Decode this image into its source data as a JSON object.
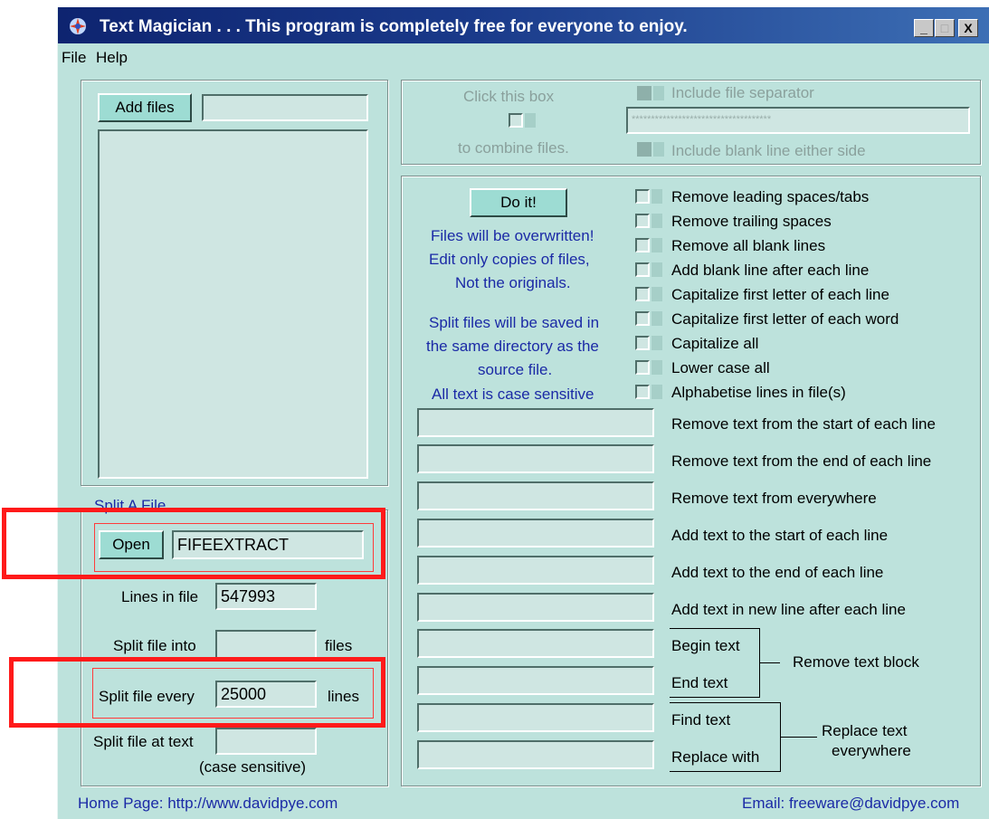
{
  "window": {
    "title": "Text Magician . . . This program is completely free for everyone to enjoy.",
    "controls": {
      "minimize": "_",
      "maximize": "□",
      "close": "X"
    }
  },
  "menu": {
    "file": "File",
    "help": "Help"
  },
  "files_panel": {
    "add_files_label": "Add files",
    "path_value": ""
  },
  "combine_panel": {
    "click_line1": "Click this box",
    "click_line2": "to combine files.",
    "include_separator": "Include file separator",
    "separator_value": "************************************",
    "include_blank": "Include blank line either side"
  },
  "actions": {
    "do_it_label": "Do it!",
    "warning_lines": [
      "Files will be overwritten!",
      "Edit only copies of files,",
      "Not the originals."
    ],
    "split_note_lines": [
      "Split files will be saved in",
      "the same directory as the",
      "source file."
    ],
    "case_note": "All text is case sensitive"
  },
  "options": [
    "Remove leading spaces/tabs",
    "Remove trailing spaces",
    "Remove all blank lines",
    "Add blank line after each line",
    "Capitalize first letter of each line",
    "Capitalize first letter of each word",
    "Capitalize all",
    "Lower case all",
    "Alphabetise lines in file(s)"
  ],
  "text_ops": [
    "Remove text from the start of each line",
    "Remove text from the end of each line",
    "Remove text from everywhere",
    "Add text to the start of each line",
    "Add text to the end of each line",
    "Add text in new line after each line"
  ],
  "block_ops": {
    "begin_text": "Begin text",
    "end_text": "End text",
    "remove_block": "Remove text block",
    "find_text": "Find text",
    "replace_with": "Replace with",
    "replace_everywhere_line1": "Replace text",
    "replace_everywhere_line2": "everywhere"
  },
  "split": {
    "section_title": "Split A File",
    "open_label": "Open",
    "file_value": "FIFEEXTRACT",
    "lines_in_file_label": "Lines in file",
    "lines_in_file_value": "547993",
    "split_into_label": "Split file into",
    "split_into_value": "",
    "files_unit": "files",
    "split_every_label": "Split file every",
    "split_every_value": "25000",
    "lines_unit": "lines",
    "split_at_text_label": "Split file at text",
    "split_at_text_value": "",
    "case_sensitive_note": "(case sensitive)"
  },
  "footer": {
    "home_page": "Home Page: http://www.davidpye.com",
    "email": "Email: freeware@davidpye.com"
  },
  "colors": {
    "window_bg": "#bde2dc",
    "title_bar": "#0e2470",
    "highlight": "#ff1a1a",
    "note_text": "#1b2aa6"
  }
}
